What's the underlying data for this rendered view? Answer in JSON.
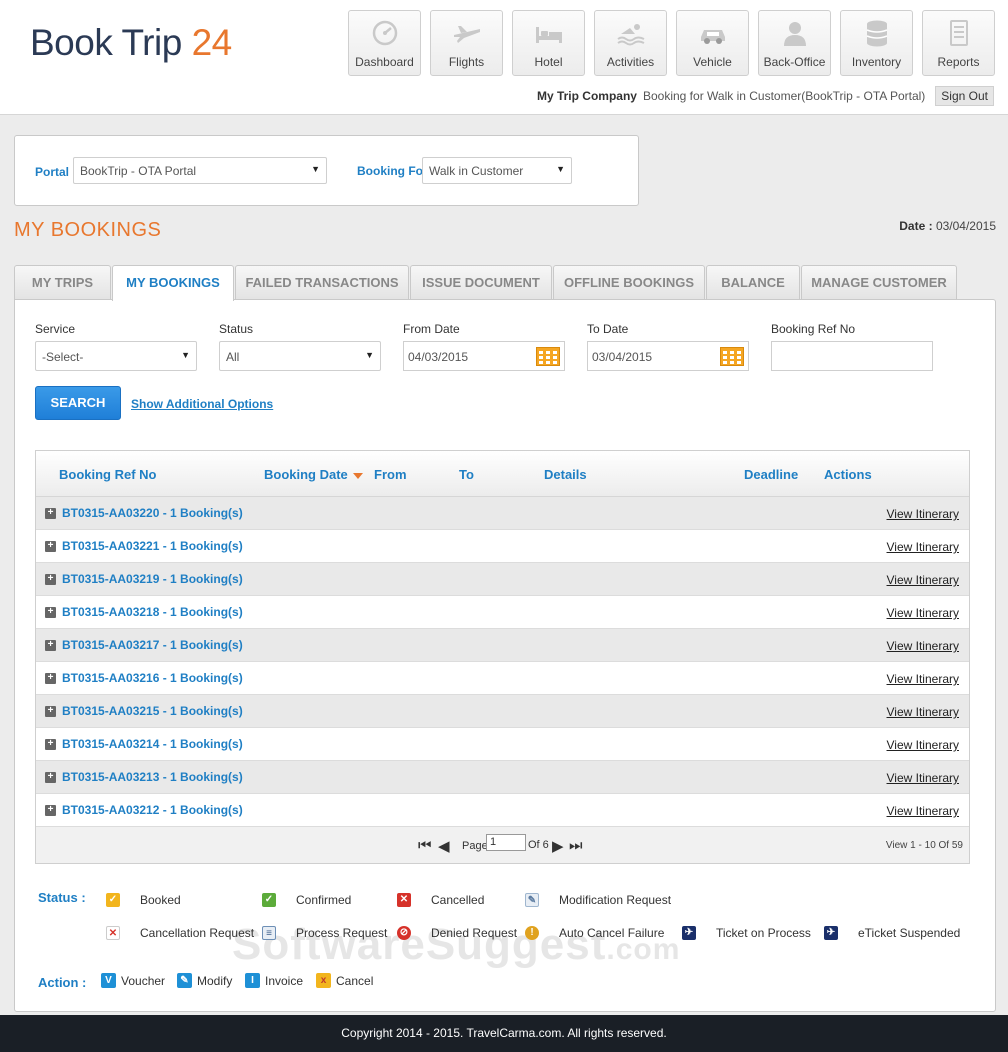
{
  "header": {
    "logo_main": "Book Trip ",
    "logo_num": "24",
    "nav": [
      {
        "label": "Dashboard",
        "icon": "dashboard-icon"
      },
      {
        "label": "Flights",
        "icon": "plane-icon"
      },
      {
        "label": "Hotel",
        "icon": "bed-icon"
      },
      {
        "label": "Activities",
        "icon": "swimmer-icon"
      },
      {
        "label": "Vehicle",
        "icon": "car-icon"
      },
      {
        "label": "Back-Office",
        "icon": "user-icon"
      },
      {
        "label": "Inventory",
        "icon": "database-icon"
      },
      {
        "label": "Reports",
        "icon": "document-icon"
      }
    ],
    "company": "My Trip Company",
    "booking_for_text": "Booking for Walk in Customer(BookTrip - OTA Portal)",
    "signout": "Sign Out"
  },
  "portal": {
    "portal_label": "Portal",
    "portal_value": "BookTrip - OTA Portal",
    "booking_for_label": "Booking For",
    "booking_for_value": "Walk in Customer"
  },
  "page": {
    "title": "MY BOOKINGS",
    "date_label": "Date : ",
    "date_value": "03/04/2015"
  },
  "tabs": [
    {
      "label": "MY TRIPS",
      "active": false
    },
    {
      "label": "MY BOOKINGS",
      "active": true
    },
    {
      "label": "FAILED TRANSACTIONS",
      "active": false
    },
    {
      "label": "ISSUE DOCUMENT",
      "active": false
    },
    {
      "label": "OFFLINE BOOKINGS",
      "active": false
    },
    {
      "label": "BALANCE",
      "active": false
    },
    {
      "label": "MANAGE CUSTOMER",
      "active": false
    }
  ],
  "filters": {
    "service_label": "Service",
    "service_value": "-Select-",
    "status_label": "Status",
    "status_value": "All",
    "from_label": "From Date",
    "from_value": "04/03/2015",
    "to_label": "To Date",
    "to_value": "03/04/2015",
    "ref_label": "Booking Ref No",
    "ref_value": "",
    "search": "SEARCH",
    "additional": "Show Additional Options"
  },
  "grid": {
    "columns": [
      "Booking Ref No",
      "Booking Date",
      "From",
      "To",
      "Details",
      "Deadline",
      "Actions"
    ],
    "rows": [
      {
        "ref": "BT0315-AA03220 - 1 Booking(s)",
        "action": "View Itinerary"
      },
      {
        "ref": "BT0315-AA03221 - 1 Booking(s)",
        "action": "View Itinerary"
      },
      {
        "ref": "BT0315-AA03219 - 1 Booking(s)",
        "action": "View Itinerary"
      },
      {
        "ref": "BT0315-AA03218 - 1 Booking(s)",
        "action": "View Itinerary"
      },
      {
        "ref": "BT0315-AA03217 - 1 Booking(s)",
        "action": "View Itinerary"
      },
      {
        "ref": "BT0315-AA03216 - 1 Booking(s)",
        "action": "View Itinerary"
      },
      {
        "ref": "BT0315-AA03215 - 1 Booking(s)",
        "action": "View Itinerary"
      },
      {
        "ref": "BT0315-AA03214 - 1 Booking(s)",
        "action": "View Itinerary"
      },
      {
        "ref": "BT0315-AA03213 - 1 Booking(s)",
        "action": "View Itinerary"
      },
      {
        "ref": "BT0315-AA03212 - 1 Booking(s)",
        "action": "View Itinerary"
      }
    ],
    "pager": {
      "page_label": "Page",
      "page_value": "1",
      "of_label": "Of 6",
      "view_text": "View 1 - 10 Of 59"
    }
  },
  "legend": {
    "status_label": "Status :",
    "items": [
      {
        "label": "Booked",
        "icon": "booked-icon",
        "color": "#f2b51d"
      },
      {
        "label": "Confirmed",
        "icon": "confirmed-icon",
        "color": "#5cab3a"
      },
      {
        "label": "Cancelled",
        "icon": "cancelled-icon",
        "color": "#d6322a"
      },
      {
        "label": "Modification Request",
        "icon": "modification-icon",
        "color": "#9fb6cf"
      },
      {
        "label": "Cancellation Request",
        "icon": "cancellation-request-icon",
        "color": "#d6322a"
      },
      {
        "label": "Process Request",
        "icon": "process-request-icon",
        "color": "#6d8fb6"
      },
      {
        "label": "Denied Request",
        "icon": "denied-request-icon",
        "color": "#d6322a"
      },
      {
        "label": "Auto Cancel Failure",
        "icon": "auto-cancel-failure-icon",
        "color": "#e0a21f"
      },
      {
        "label": "Ticket on Process",
        "icon": "ticket-process-icon",
        "color": "#1a2f6a"
      },
      {
        "label": "eTicket Suspended",
        "icon": "eticket-suspended-icon",
        "color": "#1a2f6a"
      }
    ],
    "action_label": "Action :",
    "actions": [
      {
        "label": "Voucher",
        "icon": "voucher-icon",
        "letter": "V",
        "color": "#1e90d6"
      },
      {
        "label": "Modify",
        "icon": "modify-icon",
        "letter": "✎",
        "color": "#1e90d6"
      },
      {
        "label": "Invoice",
        "icon": "invoice-icon",
        "letter": "I",
        "color": "#1e90d6"
      },
      {
        "label": "Cancel",
        "icon": "cancel-icon",
        "letter": "x",
        "color": "#f2b51d"
      }
    ]
  },
  "watermark": {
    "main": "SoftwareSuggest",
    "domain": ".com"
  },
  "footer": {
    "copyright": "Copyright 2014 - 2015. TravelCarma.com. All rights reserved."
  }
}
